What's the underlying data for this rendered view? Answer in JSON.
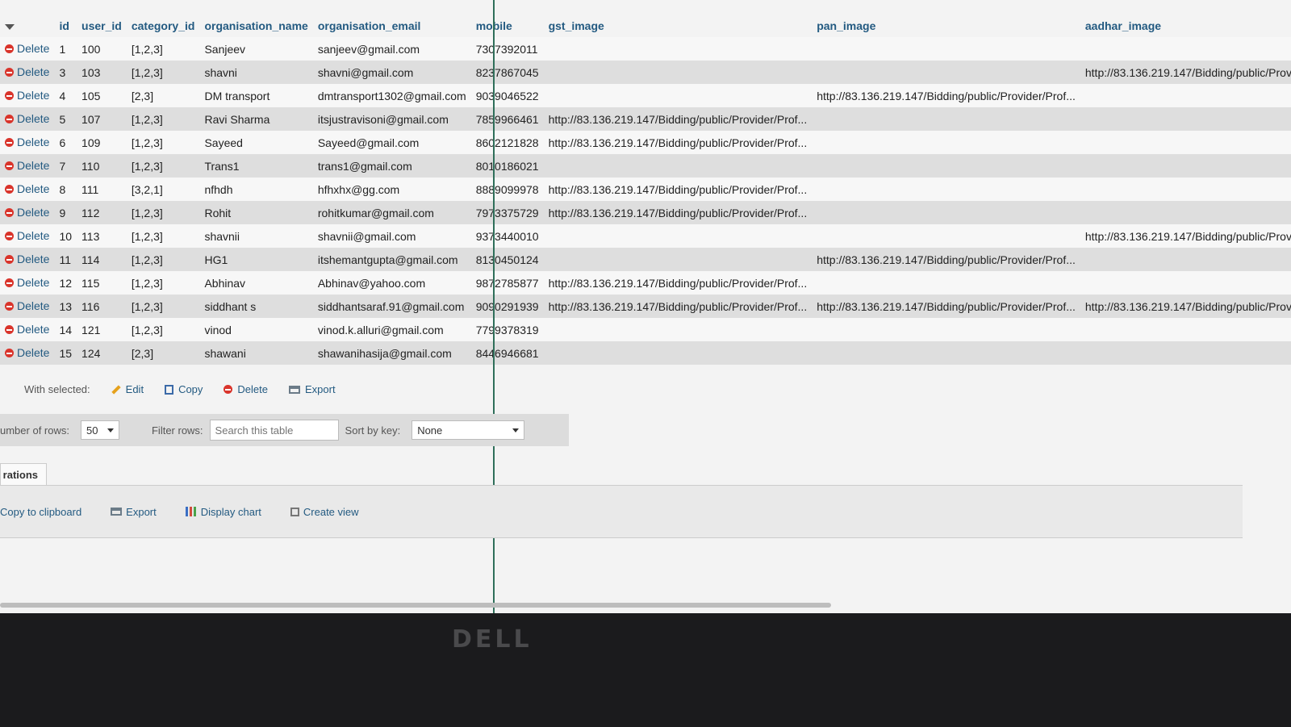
{
  "table": {
    "columns": [
      "id",
      "user_id",
      "category_id",
      "organisation_name",
      "organisation_email",
      "mobile",
      "gst_image",
      "pan_image",
      "aadhar_image"
    ],
    "delete_label": "Delete",
    "rows": [
      {
        "id": "1",
        "user_id": "100",
        "category_id": "[1,2,3]",
        "organisation_name": "Sanjeev",
        "organisation_email": "sanjeev@gmail.com",
        "mobile": "7307392011",
        "gst_image": "",
        "pan_image": "",
        "aadhar_image": ""
      },
      {
        "id": "3",
        "user_id": "103",
        "category_id": "[1,2,3]",
        "organisation_name": "shavni",
        "organisation_email": "shavni@gmail.com",
        "mobile": "8237867045",
        "gst_image": "",
        "pan_image": "",
        "aadhar_image": "http://83.136.219.147/Bidding/public/Prov"
      },
      {
        "id": "4",
        "user_id": "105",
        "category_id": "[2,3]",
        "organisation_name": "DM transport",
        "organisation_email": "dmtransport1302@gmail.com",
        "mobile": "9039046522",
        "gst_image": "",
        "pan_image": "http://83.136.219.147/Bidding/public/Provider/Prof...",
        "aadhar_image": ""
      },
      {
        "id": "5",
        "user_id": "107",
        "category_id": "[1,2,3]",
        "organisation_name": "Ravi Sharma",
        "organisation_email": "itsjustravisoni@gmail.com",
        "mobile": "7859966461",
        "gst_image": "http://83.136.219.147/Bidding/public/Provider/Prof...",
        "pan_image": "",
        "aadhar_image": ""
      },
      {
        "id": "6",
        "user_id": "109",
        "category_id": "[1,2,3]",
        "organisation_name": "Sayeed",
        "organisation_email": "Sayeed@gmail.com",
        "mobile": "8602121828",
        "gst_image": "http://83.136.219.147/Bidding/public/Provider/Prof...",
        "pan_image": "",
        "aadhar_image": ""
      },
      {
        "id": "7",
        "user_id": "110",
        "category_id": "[1,2,3]",
        "organisation_name": "Trans1",
        "organisation_email": "trans1@gmail.com",
        "mobile": "8010186021",
        "gst_image": "",
        "pan_image": "",
        "aadhar_image": ""
      },
      {
        "id": "8",
        "user_id": "111",
        "category_id": "[3,2,1]",
        "organisation_name": "nfhdh",
        "organisation_email": "hfhxhx@gg.com",
        "mobile": "8889099978",
        "gst_image": "http://83.136.219.147/Bidding/public/Provider/Prof...",
        "pan_image": "",
        "aadhar_image": ""
      },
      {
        "id": "9",
        "user_id": "112",
        "category_id": "[1,2,3]",
        "organisation_name": "Rohit",
        "organisation_email": "rohitkumar@gmail.com",
        "mobile": "7973375729",
        "gst_image": "http://83.136.219.147/Bidding/public/Provider/Prof...",
        "pan_image": "",
        "aadhar_image": ""
      },
      {
        "id": "10",
        "user_id": "113",
        "category_id": "[1,2,3]",
        "organisation_name": "shavnii",
        "organisation_email": "shavnii@gmail.com",
        "mobile": "9373440010",
        "gst_image": "",
        "pan_image": "",
        "aadhar_image": "http://83.136.219.147/Bidding/public/Provider"
      },
      {
        "id": "11",
        "user_id": "114",
        "category_id": "[1,2,3]",
        "organisation_name": "HG1",
        "organisation_email": "itshemantgupta@gmail.com",
        "mobile": "8130450124",
        "gst_image": "",
        "pan_image": "http://83.136.219.147/Bidding/public/Provider/Prof...",
        "aadhar_image": ""
      },
      {
        "id": "12",
        "user_id": "115",
        "category_id": "[1,2,3]",
        "organisation_name": "Abhinav",
        "organisation_email": "Abhinav@yahoo.com",
        "mobile": "9872785877",
        "gst_image": "http://83.136.219.147/Bidding/public/Provider/Prof...",
        "pan_image": "",
        "aadhar_image": ""
      },
      {
        "id": "13",
        "user_id": "116",
        "category_id": "[1,2,3]",
        "organisation_name": "siddhant s",
        "organisation_email": "siddhantsaraf.91@gmail.com",
        "mobile": "9090291939",
        "gst_image": "http://83.136.219.147/Bidding/public/Provider/Prof...",
        "pan_image": "http://83.136.219.147/Bidding/public/Provider/Prof...",
        "aadhar_image": "http://83.136.219.147/Bidding/public/Provider"
      },
      {
        "id": "14",
        "user_id": "121",
        "category_id": "[1,2,3]",
        "organisation_name": "vinod",
        "organisation_email": "vinod.k.alluri@gmail.com",
        "mobile": "7799378319",
        "gst_image": "",
        "pan_image": "",
        "aadhar_image": ""
      },
      {
        "id": "15",
        "user_id": "124",
        "category_id": "[2,3]",
        "organisation_name": "shawani",
        "organisation_email": "shawanihasija@gmail.com",
        "mobile": "8446946681",
        "gst_image": "",
        "pan_image": "",
        "aadhar_image": ""
      }
    ]
  },
  "bulk_actions": {
    "label": "With selected:",
    "edit": "Edit",
    "copy": "Copy",
    "delete": "Delete",
    "export": "Export"
  },
  "navigation": {
    "rows_label": "umber of rows:",
    "rows_value": "50",
    "filter_label": "Filter rows:",
    "filter_placeholder": "Search this table",
    "sort_label": "Sort by key:",
    "sort_value": "None"
  },
  "operations": {
    "tab_label": "rations",
    "copy_clipboard": "Copy to clipboard",
    "export": "Export",
    "display_chart": "Display chart",
    "create_view": "Create view"
  },
  "bezel": {
    "logo": "DELL"
  }
}
